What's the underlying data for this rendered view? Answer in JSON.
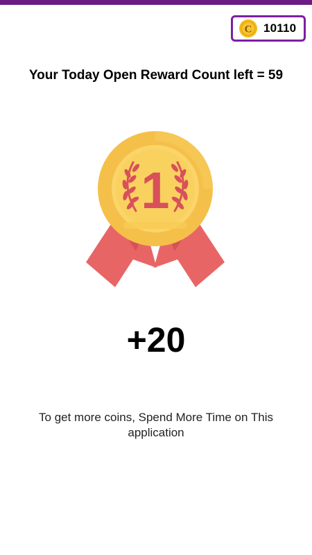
{
  "header": {
    "coin_balance": "10110",
    "coin_icon": "coin-c-icon",
    "accent_color": "#7b1fa2",
    "top_bar_color": "#6a1b86"
  },
  "reward": {
    "title": "Your Today Open Reward Count left = 59",
    "medal_icon": "first-place-medal-icon",
    "medal_number": "1",
    "amount": "+20",
    "hint": "To get more coins, Spend More Time on This application"
  }
}
